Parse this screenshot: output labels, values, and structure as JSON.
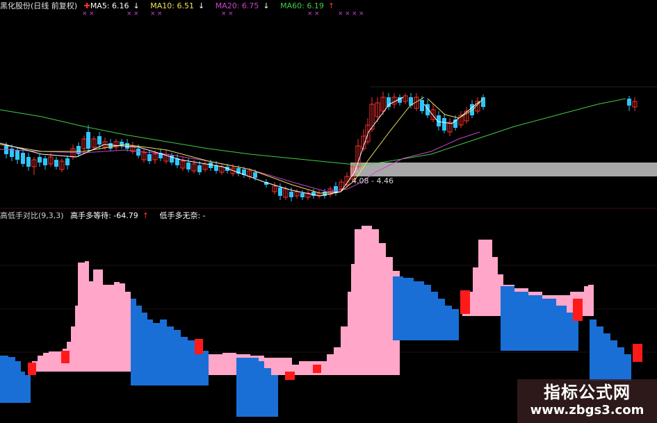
{
  "colors": {
    "background": "#000000",
    "up": "#ff3030",
    "down": "#2ec6ff",
    "ma5": "#ffffff",
    "ma10": "#f0e060",
    "ma20": "#cc44cc",
    "ma60": "#44cc44",
    "pink": "#ffa6c9",
    "blue": "#1a6fd6",
    "red_marker": "#ff1a1a"
  },
  "price_panel": {
    "stock_name": "黑化股份(日线 前复权)",
    "ma5": {
      "label": "MA5: 6.16",
      "arrow": "↓"
    },
    "ma10": {
      "label": "MA10: 6.51",
      "arrow": "↓"
    },
    "ma20": {
      "label": "MA20: 6.75",
      "arrow": "↓"
    },
    "ma60": {
      "label": "MA60: 6.19",
      "arrow": "↑"
    },
    "range_label": "4.08 - 4.46"
  },
  "indicator_panel": {
    "name": "高低手对比(9,3,3)",
    "item1": "高手多等待: -64.79",
    "item1_arrow": "↑",
    "item2": "低手多无奈: -"
  },
  "watermark": {
    "title": "指标公式网",
    "url": "www.zbgs3.com"
  }
}
